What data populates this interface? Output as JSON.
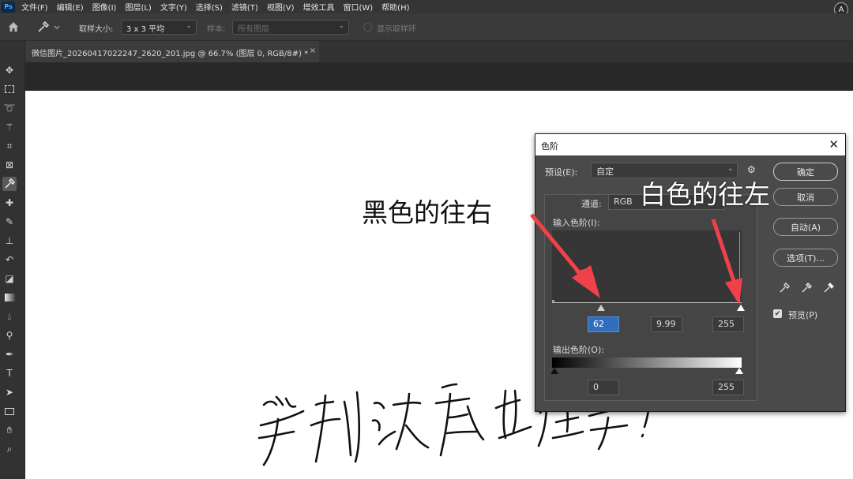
{
  "app": {
    "logo": "Ps"
  },
  "menu": [
    "文件(F)",
    "编辑(E)",
    "图像(I)",
    "图层(L)",
    "文字(Y)",
    "选择(S)",
    "滤镜(T)",
    "视图(V)",
    "增效工具",
    "窗口(W)",
    "帮助(H)"
  ],
  "account_icon": "A",
  "options": {
    "sample_size_label": "取样大小:",
    "sample_size_value": "3 x 3 平均",
    "sample_label": "样本:",
    "sample_value": "所有图层",
    "show_ring": "显示取样环"
  },
  "document_tab": {
    "title": "微信图片_20260417022247_2620_201.jpg @ 66.7% (图层 0, RGB/8#) *",
    "close": "×"
  },
  "annotations": {
    "black_right": "黑色的往右",
    "white_left": "白色的往左"
  },
  "levels": {
    "title": "色阶",
    "close": "✕",
    "preset_label": "预设(E):",
    "preset_value": "自定",
    "channel_label": "通道:",
    "channel_value": "RGB",
    "input_label": "输入色阶(I):",
    "input_black": "62",
    "input_gamma": "9.99",
    "input_white": "255",
    "output_label": "输出色阶(O):",
    "output_black": "0",
    "output_white": "255",
    "buttons": {
      "ok": "确定",
      "cancel": "取消",
      "auto": "自动(A)",
      "options": "选项(T)..."
    },
    "preview_label": "预览(P)",
    "preview_checked": true
  },
  "colors": {
    "arrow": "#f0414b",
    "accent": "#2f6ebf"
  }
}
